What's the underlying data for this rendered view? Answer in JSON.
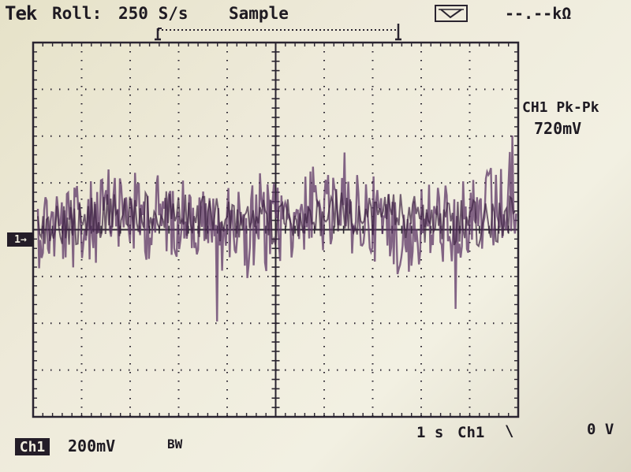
{
  "header": {
    "brand": "Tek",
    "mode": "Roll:",
    "sample_rate": "250 S/s",
    "acquisition": "Sample",
    "probe_icon": "probe-icon",
    "impedance": "--.--kΩ"
  },
  "measurement": {
    "title": "CH1 Pk-Pk",
    "value": "720mV"
  },
  "footer": {
    "channel": "Ch1",
    "volts_per_div": "200mV",
    "bandwidth": "BW",
    "time_per_div": "1 s",
    "trigger_source": "Ch1",
    "trigger_slope": "\\",
    "trigger_level": "0 V"
  },
  "marker": {
    "channel_ground": "1→"
  },
  "colors": {
    "trace": "#5c3566",
    "trace_dark": "#3a2040",
    "grid": "#2a2430"
  }
}
